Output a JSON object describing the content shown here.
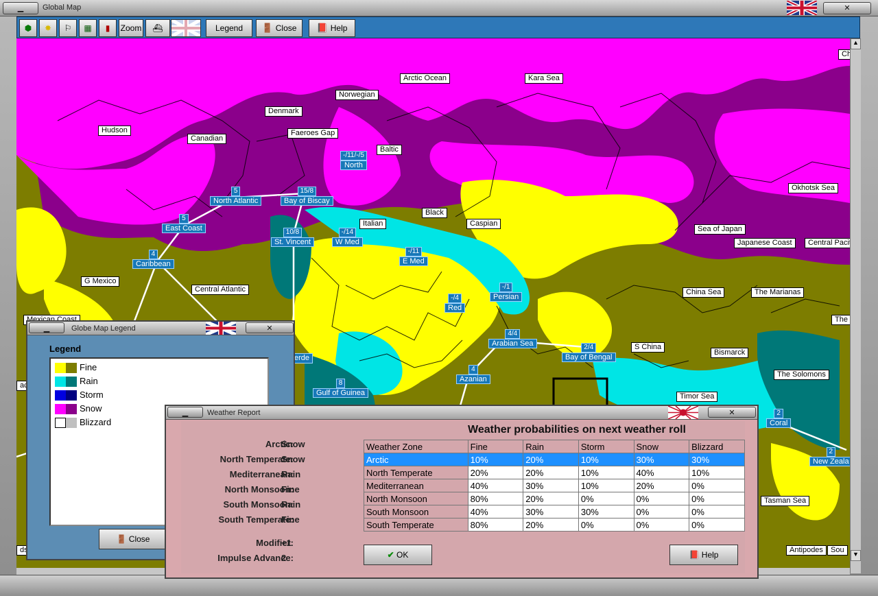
{
  "window": {
    "title": "Global Map"
  },
  "toolbar": {
    "zoom_label": "Zoom",
    "legend_label": "Legend",
    "close_label": "Close",
    "help_label": "Help"
  },
  "colors": {
    "toolbar": "#2e78b8",
    "label_bg": "#1778b8",
    "snow": "#ff00ff",
    "snow_dark": "#8b008b",
    "fine": "#ffff00",
    "fine_dark": "#7d7d00",
    "rain": "#00e5e5",
    "rain_dark": "#007878"
  },
  "map": {
    "labels": [
      "Ch",
      "Arctic Ocean",
      "Kara Sea",
      "Norwegian",
      "Denmark",
      "Hudson",
      "Canadian",
      "Faeroes Gap",
      "Baltic",
      "Okhotsk Sea",
      "Black",
      "Italian",
      "Caspian",
      "Sea of Japan",
      "Japanese Coast",
      "Central Pacit",
      "G Mexico",
      "Central Atlantic",
      "China Sea",
      "The Marianas",
      "Mexican Coast",
      "The Ma",
      "S China",
      "Bismarck",
      "The Solomons",
      "Timor Sea",
      "Tasman Sea",
      "Antipodes",
      "Sou",
      "acit",
      "rn",
      "ds",
      "erde"
    ],
    "sea_zones": [
      {
        "value": "-/11/-/5",
        "name": "North"
      },
      {
        "value": "5",
        "name": "North Atlantic"
      },
      {
        "value": "15/8",
        "name": "Bay of Biscay"
      },
      {
        "value": "5",
        "name": "East Coast"
      },
      {
        "value": "10/8",
        "name": "St. Vincent"
      },
      {
        "value": "-/14",
        "name": "W Med"
      },
      {
        "value": "-/11",
        "name": "E Med"
      },
      {
        "value": "4",
        "name": "Caribbean"
      },
      {
        "value": "-/1",
        "name": "Persian"
      },
      {
        "value": "-/4",
        "name": "Red"
      },
      {
        "value": "4/4",
        "name": "Arabian Sea"
      },
      {
        "value": "2/4",
        "name": "Bay of Bengal"
      },
      {
        "value": "4",
        "name": "Azanian"
      },
      {
        "value": "8",
        "name": "Gulf of Guinea"
      },
      {
        "value": "2",
        "name": "Coral"
      },
      {
        "value": "2",
        "name": "New Zeala"
      }
    ]
  },
  "legend_window": {
    "title": "Globe Map Legend",
    "heading": "Legend",
    "items": [
      {
        "label": "Fine",
        "c1": "#ffff00",
        "c2": "#7d7d00"
      },
      {
        "label": "Rain",
        "c1": "#00e5e5",
        "c2": "#007878"
      },
      {
        "label": "Storm",
        "c1": "#0000e0",
        "c2": "#000080"
      },
      {
        "label": "Snow",
        "c1": "#ff00ff",
        "c2": "#8b008b"
      },
      {
        "label": "Blizzard",
        "c1": "#ffffff",
        "c2": "#c0c0c0"
      }
    ],
    "close_label": "Close"
  },
  "weather_window": {
    "title": "Weather Report",
    "heading": "Weather probabilities on next weather roll",
    "zone_results": [
      {
        "zone": "Arctic:",
        "weather": "Snow"
      },
      {
        "zone": "North Temperate:",
        "weather": "Snow"
      },
      {
        "zone": "Mediterranean:",
        "weather": "Rain"
      },
      {
        "zone": "North Monsoon:",
        "weather": "Fine"
      },
      {
        "zone": "South Monsoon:",
        "weather": "Rain"
      },
      {
        "zone": "South Temperate:",
        "weather": "Fine"
      }
    ],
    "modifier_label": "Modifier:",
    "modifier_value": "+1",
    "impulse_label": "Impulse Advance:",
    "impulse_value": "2",
    "table": {
      "headers": [
        "Weather Zone",
        "Fine",
        "Rain",
        "Storm",
        "Snow",
        "Blizzard"
      ],
      "rows": [
        [
          "Arctic",
          "10%",
          "20%",
          "10%",
          "30%",
          "30%"
        ],
        [
          "North Temperate",
          "20%",
          "20%",
          "10%",
          "40%",
          "10%"
        ],
        [
          "Mediterranean",
          "40%",
          "30%",
          "10%",
          "20%",
          "0%"
        ],
        [
          "North Monsoon",
          "80%",
          "20%",
          "0%",
          "0%",
          "0%"
        ],
        [
          "South Monsoon",
          "40%",
          "30%",
          "30%",
          "0%",
          "0%"
        ],
        [
          "South Temperate",
          "80%",
          "20%",
          "0%",
          "0%",
          "0%"
        ]
      ],
      "selected_row": 0
    },
    "ok_label": "OK",
    "help_label": "Help"
  }
}
